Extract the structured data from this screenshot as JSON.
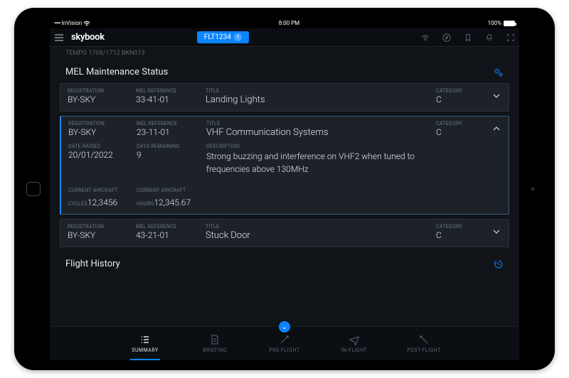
{
  "statusbar": {
    "carrier": "InVision",
    "time": "8:00 PM",
    "battery": "100%"
  },
  "topbar": {
    "logo": "skybook",
    "flight": "FLT1234"
  },
  "tempo": "TEMPO 1708/1712 BKN013",
  "sections": {
    "mel_title": "MEL Maintenance Status",
    "history_title": "Flight History"
  },
  "labels": {
    "registration": "REGISTRATION",
    "mel_ref": "MEL REFERENCE",
    "title": "TITLE",
    "category": "CATEGORY",
    "date_raised": "DATE RAISED",
    "days_remaining": "DAYS REMAINING",
    "description": "DESCRIPTION",
    "cycles": "CURRENT AIRCRAFT CYCLES",
    "hours": "CURRENT AIRCRAFT HOURS"
  },
  "mel": [
    {
      "registration": "BY-SKY",
      "mel_ref": "33-41-01",
      "title": "Landing Lights",
      "category": "C",
      "expanded": false
    },
    {
      "registration": "BY-SKY",
      "mel_ref": "23-11-01",
      "title": "VHF Communication Systems",
      "category": "C",
      "expanded": true,
      "date_raised": "20/01/2022",
      "days_remaining": "9",
      "description": "Strong buzzing and interference on VHF2 when tuned to frequencies above 130MHz",
      "cycles": "12,3456",
      "hours": "12,345.67"
    },
    {
      "registration": "BY-SKY",
      "mel_ref": "43-21-01",
      "title": "Stuck Door",
      "category": "C",
      "expanded": false
    }
  ],
  "nav": {
    "items": [
      "SUMMARY",
      "BRIEFING",
      "PRE-FLIGHT",
      "IN-FLIGHT",
      "POST-FLIGHT"
    ],
    "active": 0
  }
}
